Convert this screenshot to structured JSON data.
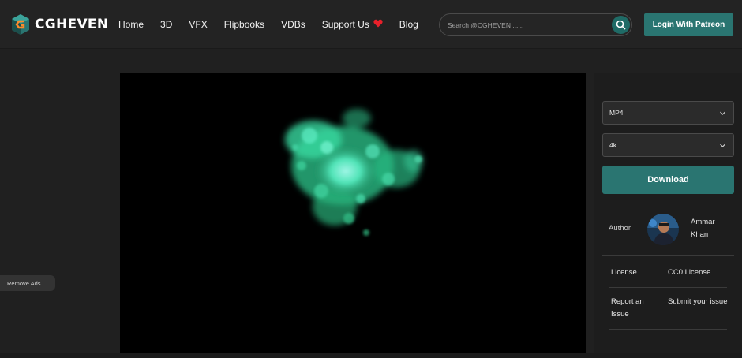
{
  "brand": {
    "name": "CGHEVEN"
  },
  "nav": {
    "items": [
      "Home",
      "3D",
      "VFX",
      "Flipbooks",
      "VDBs",
      "Support Us",
      "Blog"
    ]
  },
  "search": {
    "placeholder": "Search @CGHEVEN ......"
  },
  "header": {
    "login_label": "Login With Patreon"
  },
  "ads": {
    "remove_label": "Remove Ads"
  },
  "download": {
    "format": "MP4",
    "resolution": "4k",
    "button_label": "Download"
  },
  "author": {
    "label": "Author",
    "name": "Ammar Khan"
  },
  "info": {
    "license_label": "License",
    "license_value": "CC0 License",
    "report_label": "Report an Issue",
    "submit_label": "Submit your issue"
  },
  "colors": {
    "accent": "#2a7571",
    "background": "#202020",
    "smoke": "#3fe0a8"
  },
  "icons": {
    "logo": "cgheven-cube-logo",
    "heart": "heart-icon",
    "search": "search-icon",
    "chevron": "chevron-down-icon"
  }
}
